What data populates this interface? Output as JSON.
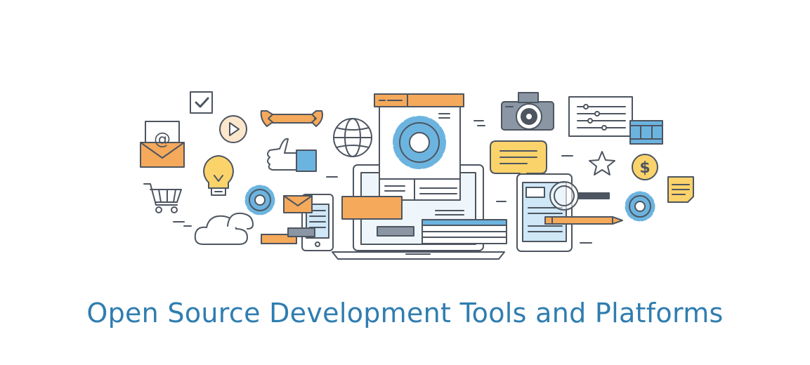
{
  "title": "Open Source Development Tools and Platforms",
  "colors": {
    "title": "#2f7db0",
    "outline": "#4d5560",
    "orange": "#f5a95b",
    "yellow": "#fbd36b",
    "blue": "#6cb4e0",
    "light_blue": "#cfe7f6",
    "gray": "#8a96a3",
    "white": "#ffffff"
  },
  "illustration": {
    "icons": [
      "email-envelope-icon",
      "checkbox-icon",
      "play-button-icon",
      "wrench-icon",
      "globe-icon",
      "thumbs-up-icon",
      "light-bulb-icon",
      "shopping-cart-icon",
      "gear-icon",
      "cloud-icon",
      "mail-icon",
      "smartphone-icon",
      "laptop-icon",
      "settings-window-icon",
      "camera-icon",
      "sliders-panel-icon",
      "film-strip-icon",
      "speech-bubble-icon",
      "star-icon",
      "dollar-coin-icon",
      "sticky-note-icon",
      "tablet-icon",
      "magnifier-icon",
      "pencil-icon"
    ],
    "at_symbol": "@",
    "dollar_symbol": "$"
  }
}
